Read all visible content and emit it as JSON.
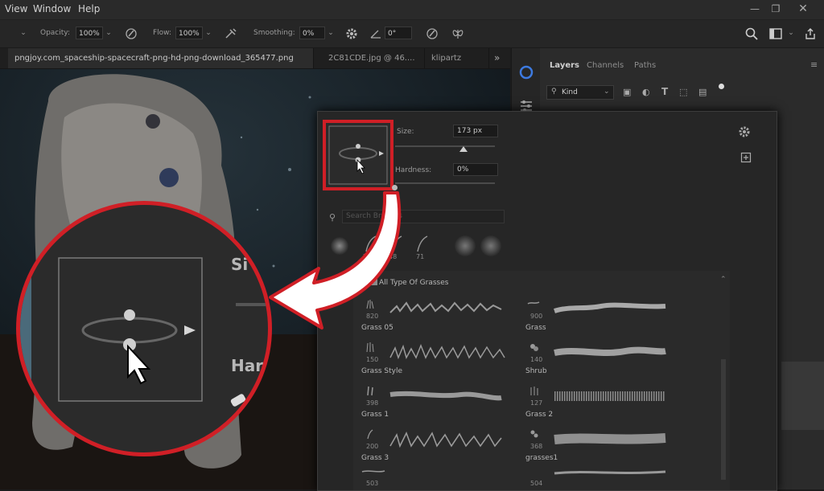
{
  "menu": {
    "items": [
      "View",
      "Window",
      "Help"
    ]
  },
  "options": {
    "opacity_label": "Opacity:",
    "opacity_value": "100%",
    "flow_label": "Flow:",
    "flow_value": "100%",
    "smoothing_label": "Smoothing:",
    "smoothing_value": "0%",
    "angle_value": "0°"
  },
  "tabs": [
    "pngjoy.com_spaceship-spacecraft-png-hd-png-download_365477.png",
    "2C81CDE.jpg @ 46....",
    "klipartz"
  ],
  "tab_overflow": "»",
  "panel": {
    "tabs": [
      "Layers",
      "Channels",
      "Paths"
    ],
    "kind_filter": "Kind"
  },
  "brush_popup": {
    "size_label": "Size:",
    "size_value": "173 px",
    "hardness_label": "Hardness:",
    "hardness_value": "0%",
    "search_placeholder": "Search Brushes",
    "recent_sizes": [
      "29",
      "48",
      "71"
    ],
    "group_name": "All Type Of Grasses",
    "brushes": [
      {
        "num": "820",
        "name": "Grass 05"
      },
      {
        "num": "900",
        "name": "Grass"
      },
      {
        "num": "150",
        "name": "Grass Style"
      },
      {
        "num": "140",
        "name": "Shrub"
      },
      {
        "num": "398",
        "name": "Grass 1"
      },
      {
        "num": "127",
        "name": "Grass 2"
      },
      {
        "num": "200",
        "name": "Grass 3"
      },
      {
        "num": "368",
        "name": "grasses1"
      },
      {
        "num": "503",
        "name": ""
      },
      {
        "num": "504",
        "name": ""
      }
    ]
  },
  "zoom": {
    "size_label_partial": "Si",
    "hardness_label_partial": "Har"
  },
  "colors": {
    "highlight": "#d01f26",
    "panel_bg": "#262626",
    "canvas_bg": "#0e1417"
  }
}
